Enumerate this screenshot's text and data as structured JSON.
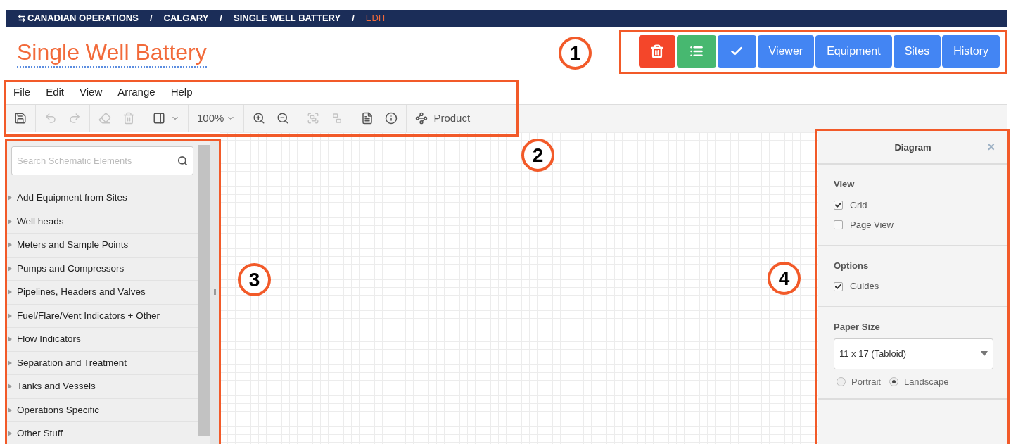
{
  "breadcrumb": {
    "items": [
      {
        "label": "CANADIAN OPERATIONS",
        "selected": false
      },
      {
        "label": "CALGARY",
        "selected": false
      },
      {
        "label": "SINGLE WELL BATTERY",
        "selected": false
      },
      {
        "label": "EDIT",
        "selected": true
      }
    ],
    "separators": [
      "/",
      "/",
      "/"
    ]
  },
  "page_title": "Single Well Battery",
  "actions": [
    {
      "kind": "delete"
    },
    {
      "kind": "list"
    },
    {
      "kind": "confirm"
    },
    {
      "kind": "text",
      "label": "Viewer"
    },
    {
      "kind": "text",
      "label": "Equipment"
    },
    {
      "kind": "text",
      "label": "Sites"
    },
    {
      "kind": "text",
      "label": "History"
    }
  ],
  "menu": [
    "File",
    "Edit",
    "View",
    "Arrange",
    "Help"
  ],
  "toolbar": {
    "groups": [
      {
        "tools": [
          {
            "kind": "save",
            "disabled": false
          }
        ]
      },
      {
        "tools": [
          {
            "kind": "undo",
            "disabled": true
          },
          {
            "kind": "redo",
            "disabled": true
          }
        ]
      },
      {
        "tools": [
          {
            "kind": "erase",
            "disabled": true
          },
          {
            "kind": "delete",
            "disabled": true
          }
        ]
      },
      {
        "tools": [
          {
            "kind": "layout",
            "disabled": false
          }
        ]
      },
      {
        "tools": [
          {
            "kind": "zoom-select",
            "label": "100%",
            "disabled": false
          }
        ]
      },
      {
        "tools": [
          {
            "kind": "zoom-in",
            "disabled": false
          },
          {
            "kind": "zoom-out",
            "disabled": false
          }
        ]
      },
      {
        "tools": [
          {
            "kind": "group",
            "disabled": true
          },
          {
            "kind": "ungroup",
            "disabled": true
          }
        ]
      },
      {
        "tools": [
          {
            "kind": "pdf",
            "disabled": false
          },
          {
            "kind": "info",
            "disabled": false
          }
        ]
      },
      {
        "tools": [
          {
            "kind": "connector",
            "label": "Product",
            "disabled": false
          }
        ]
      }
    ]
  },
  "library": {
    "search": {
      "placeholder": "Search Schematic Elements"
    },
    "items": [
      {
        "label": "Add Equipment from Sites",
        "expanded": false
      },
      {
        "label": "Well heads",
        "expanded": false
      },
      {
        "label": "Meters and Sample Points",
        "expanded": false
      },
      {
        "label": "Pumps and Compressors",
        "expanded": false
      },
      {
        "label": "Pipelines, Headers and Valves",
        "expanded": false
      },
      {
        "label": "Fuel/Flare/Vent Indicators + Other",
        "expanded": false
      },
      {
        "label": "Flow Indicators",
        "expanded": false
      },
      {
        "label": "Separation and Treatment",
        "expanded": false
      },
      {
        "label": "Tanks and Vessels",
        "expanded": false
      },
      {
        "label": "Operations Specific",
        "expanded": false
      },
      {
        "label": "Other Stuff",
        "expanded": false
      }
    ]
  },
  "diagram_panel": {
    "title": "Diagram",
    "close": "×",
    "sections": [
      {
        "title": "View",
        "items": [
          {
            "kind": "checkbox",
            "label": "Grid",
            "checked": true
          },
          {
            "kind": "checkbox",
            "label": "Page View",
            "checked": false
          }
        ]
      },
      {
        "title": "Options",
        "items": [
          {
            "kind": "checkbox",
            "label": "Guides",
            "checked": true
          }
        ]
      },
      {
        "title": "Paper Size",
        "items": [
          {
            "kind": "select",
            "value": "11 x 17 (Tabloid)"
          },
          {
            "kind": "radios",
            "options": [
              {
                "label": "Portrait",
                "selected": false
              },
              {
                "label": "Landscape",
                "selected": true
              }
            ]
          }
        ]
      }
    ]
  },
  "annotations": [
    {
      "number": "1"
    },
    {
      "number": "2"
    },
    {
      "number": "3"
    },
    {
      "number": "4"
    }
  ]
}
